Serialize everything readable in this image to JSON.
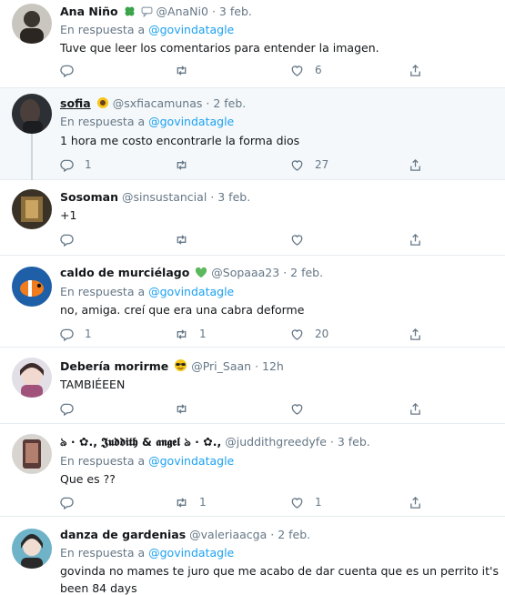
{
  "reply_prefix": "En respuesta a",
  "tweets": [
    {
      "name": "Ana Niño",
      "handle": "@AnaNi0",
      "date": "3 feb.",
      "reply_to": "@govindatagle",
      "text": "Tuve que leer los comentarios para entender la imagen.",
      "replies": "",
      "retweets": "",
      "likes": "6"
    },
    {
      "name": "sofia",
      "handle": "@sxfiacamunas",
      "date": "2 feb.",
      "reply_to": "@govindatagle",
      "text": "1 hora me costo encontrarle la forma dios",
      "replies": "1",
      "retweets": "",
      "likes": "27"
    },
    {
      "name": "Sosoman",
      "handle": "@sinsustancial",
      "date": "3 feb.",
      "reply_to": "",
      "text": "+1",
      "replies": "",
      "retweets": "",
      "likes": ""
    },
    {
      "name": "caldo de murciélago",
      "handle": "@Sopaaa23",
      "date": "2 feb.",
      "reply_to": "@govindatagle",
      "text": "no, amiga. creí que era una cabra deforme",
      "replies": "1",
      "retweets": "1",
      "likes": "20"
    },
    {
      "name": "Debería morirme",
      "handle": "@Pri_Saan",
      "date": "12h",
      "reply_to": "",
      "text": "TAMBIÉEEN",
      "replies": "",
      "retweets": "",
      "likes": ""
    },
    {
      "name": "ঌ · ✿., 𝕵𝖚𝖉𝖉𝖎𝖙𝖍 & 𝖆𝖓𝖌𝖊𝖑 ঌ · ✿.,",
      "handle": "@juddithgreedyfe",
      "date": "3 feb.",
      "reply_to": "@govindatagle",
      "text": "Que es ??",
      "replies": "",
      "retweets": "1",
      "likes": "1"
    },
    {
      "name": "danza de gardenias",
      "handle": "@valeriaacga",
      "date": "2 feb.",
      "reply_to": "@govindatagle",
      "text": "govinda no mames te juro que me acabo de dar cuenta que es un perrito it's been 84 days",
      "replies": "",
      "retweets": "",
      "likes": ""
    }
  ],
  "icons": {
    "reply": "reply-icon",
    "retweet": "retweet-icon",
    "like": "heart-icon",
    "share": "share-icon"
  },
  "colors": {
    "mention": "#1da1f2",
    "muted": "#657786",
    "text": "#14171a",
    "highlight_bg": "#f5f8fa",
    "divider": "#e6ecf0"
  }
}
